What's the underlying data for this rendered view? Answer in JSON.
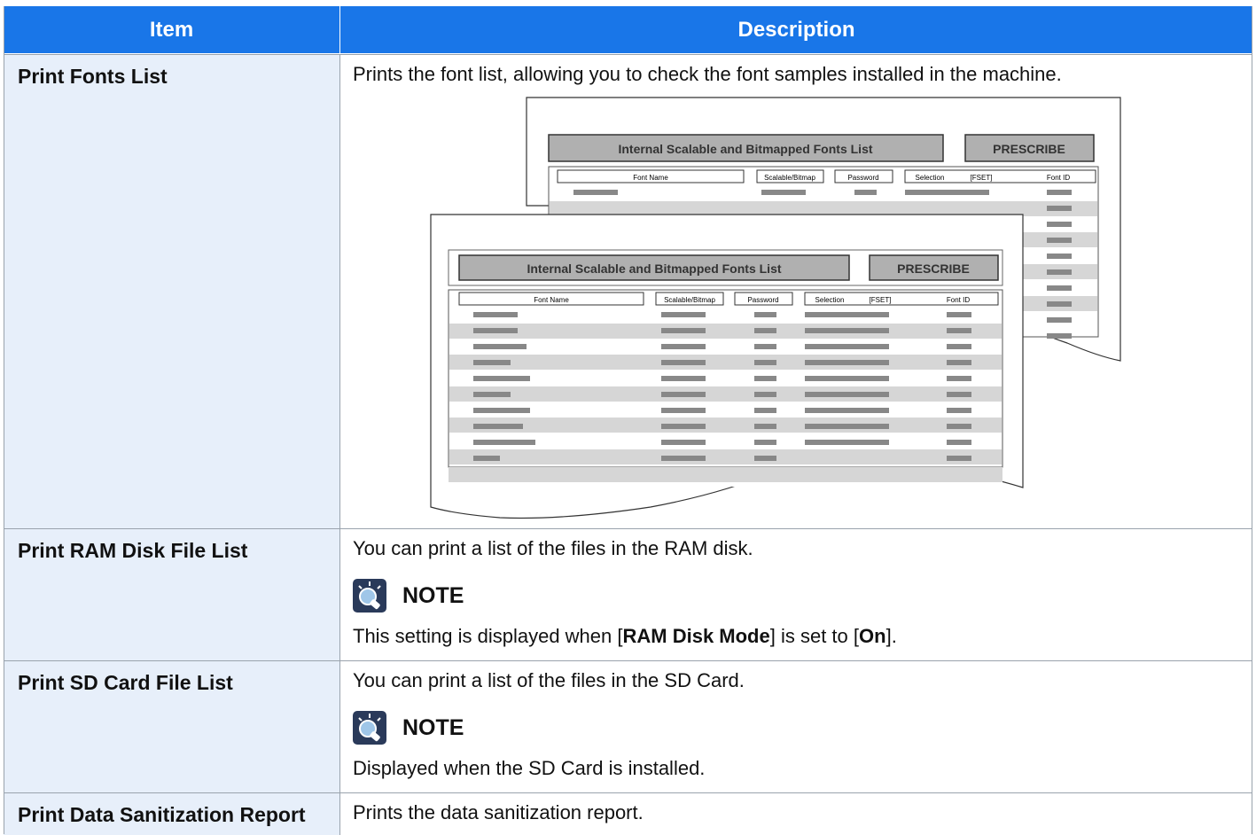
{
  "header": {
    "item": "Item",
    "description": "Description"
  },
  "rows": [
    {
      "item": "Print Fonts List",
      "description": "Prints the font list, allowing you to check the font samples installed in the machine."
    },
    {
      "item": "Print RAM Disk File List",
      "description": "You can print a list of the files in the RAM disk.",
      "note_label": "NOTE",
      "note_pre": "This setting is displayed when [",
      "note_b1": "RAM Disk Mode",
      "note_mid": "] is set to [",
      "note_b2": "On",
      "note_post": "]."
    },
    {
      "item": "Print SD Card File List",
      "description": "You can print a list of the files in the SD Card.",
      "note_label": "NOTE",
      "note_text": "Displayed when the SD Card is installed."
    },
    {
      "item": "Print Data Sanitization Report",
      "description": "Prints the data sanitization report."
    }
  ],
  "sample": {
    "title": "Internal Scalable and Bitmapped Fonts List",
    "brand": "PRESCRIBE",
    "col_font_name": "Font Name",
    "col_scalable": "Scalable/Bitmap",
    "col_password": "Password",
    "col_selection": "Selection",
    "col_fset": "[FSET]",
    "col_font_id": "Font ID"
  },
  "colors": {
    "header_bg": "#1976e8",
    "item_bg": "#e7effa",
    "border": "#9aa3ad"
  }
}
